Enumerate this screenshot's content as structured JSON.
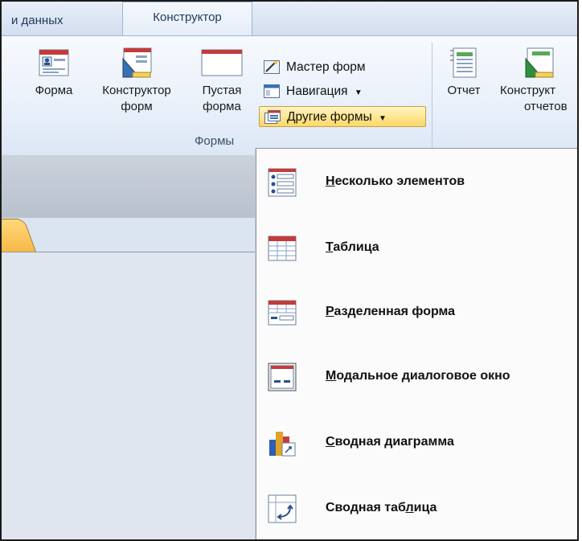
{
  "tabs": {
    "data_label": "и данных",
    "design_label": "Конструктор"
  },
  "forms_group": {
    "label": "Формы",
    "form": {
      "line1": "Форма",
      "line2": ""
    },
    "form_designer": {
      "line1": "Конструктор",
      "line2": "форм"
    },
    "blank_form": {
      "line1": "Пустая",
      "line2": "форма"
    },
    "form_wizard": "Мастер форм",
    "navigation": "Навигация",
    "more_forms": "Другие формы"
  },
  "reports_group": {
    "report": {
      "line1": "Отчет"
    },
    "report_designer": {
      "line1": "Конструкт",
      "line2": "отчетов"
    }
  },
  "menu": {
    "items": [
      {
        "pre": "",
        "key": "Н",
        "post": "есколько элементов"
      },
      {
        "pre": "",
        "key": "Т",
        "post": "аблица"
      },
      {
        "pre": "",
        "key": "Р",
        "post": "азделенная форма"
      },
      {
        "pre": "",
        "key": "М",
        "post": "одальное диалоговое окно"
      },
      {
        "pre": "",
        "key": "С",
        "post": "водная диаграмма"
      },
      {
        "pre": "Сводная таб",
        "key": "л",
        "post": "ица"
      }
    ]
  },
  "colors": {
    "ribbon_accent": "#1e395b",
    "active_button": "#fcd866",
    "doc_tab": "#f8b745"
  }
}
